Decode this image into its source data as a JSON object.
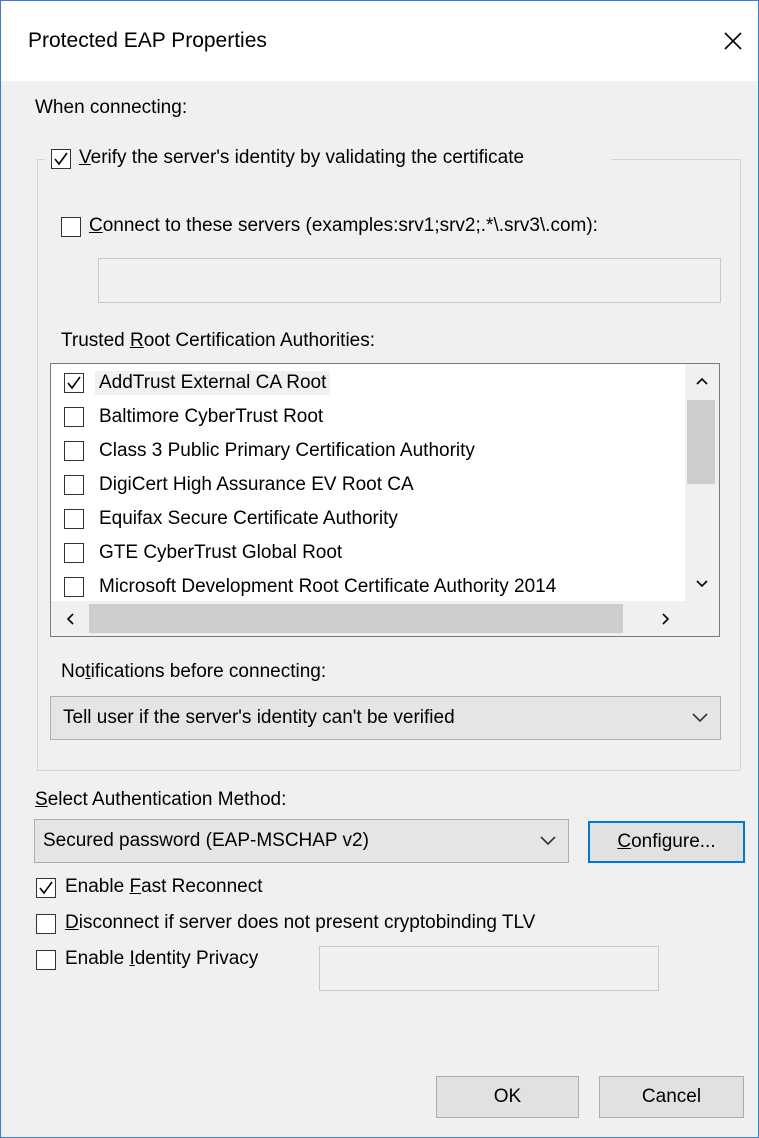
{
  "window": {
    "title": "Protected EAP Properties"
  },
  "when_connecting_label": "When connecting:",
  "verify": {
    "checked": true,
    "label_pre": "",
    "label_ul": "V",
    "label_post": "erify the server's identity by validating the certificate"
  },
  "connect_servers": {
    "checked": false,
    "label_pre": "",
    "label_ul": "C",
    "label_post": "onnect to these servers (examples:srv1;srv2;.*\\.srv3\\.com):",
    "value": ""
  },
  "trusted_root": {
    "label_pre": "Trusted ",
    "label_ul": "R",
    "label_post": "oot Certification Authorities:",
    "items": [
      {
        "label": "AddTrust External CA Root",
        "checked": true
      },
      {
        "label": "Baltimore CyberTrust Root",
        "checked": false
      },
      {
        "label": "Class 3 Public Primary Certification Authority",
        "checked": false
      },
      {
        "label": "DigiCert High Assurance EV Root CA",
        "checked": false
      },
      {
        "label": "Equifax Secure Certificate Authority",
        "checked": false
      },
      {
        "label": "GTE CyberTrust Global Root",
        "checked": false
      },
      {
        "label": "Microsoft Development Root Certificate Authority 2014",
        "checked": false
      }
    ]
  },
  "notifications": {
    "label_pre": "No",
    "label_ul": "t",
    "label_post": "ifications before connecting:",
    "selected": "Tell user if the server's identity can't be verified"
  },
  "auth_method": {
    "label_pre": "",
    "label_ul": "S",
    "label_post": "elect Authentication Method:",
    "selected": "Secured password (EAP-MSCHAP v2)",
    "configure_pre": "",
    "configure_ul": "C",
    "configure_post": "onfigure..."
  },
  "fast_reconnect": {
    "checked": true,
    "label_pre": "Enable ",
    "label_ul": "F",
    "label_post": "ast Reconnect"
  },
  "disconnect_tlv": {
    "checked": false,
    "label_pre": "",
    "label_ul": "D",
    "label_post": "isconnect if server does not present cryptobinding TLV"
  },
  "identity_privacy": {
    "checked": false,
    "label_pre": "Enable ",
    "label_ul": "I",
    "label_post": "dentity Privacy",
    "value": ""
  },
  "buttons": {
    "ok": "OK",
    "cancel": "Cancel"
  },
  "colors": {
    "accent": "#0078d7",
    "window_border": "#3a7bd5",
    "face": "#f0f0f0"
  }
}
